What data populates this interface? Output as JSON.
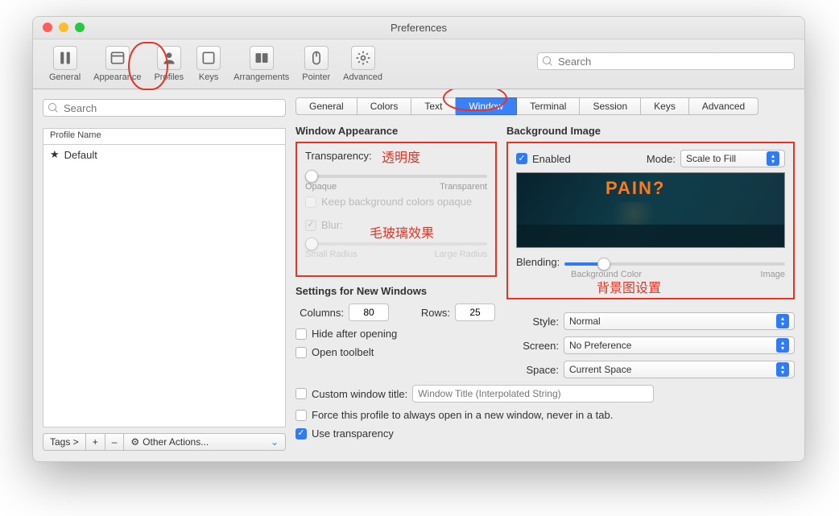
{
  "title": "Preferences",
  "toolbar": [
    {
      "id": "general",
      "label": "General"
    },
    {
      "id": "appearance",
      "label": "Appearance"
    },
    {
      "id": "profiles",
      "label": "Profiles"
    },
    {
      "id": "keys",
      "label": "Keys"
    },
    {
      "id": "arrangements",
      "label": "Arrangements"
    },
    {
      "id": "pointer",
      "label": "Pointer"
    },
    {
      "id": "advanced",
      "label": "Advanced"
    }
  ],
  "top_search_placeholder": "Search",
  "sidebar": {
    "search_placeholder": "Search",
    "header": "Profile Name",
    "items": [
      {
        "label": "Default",
        "starred": true
      }
    ],
    "footer": {
      "tags": "Tags >",
      "plus": "+",
      "minus": "–",
      "other": "Other Actions..."
    }
  },
  "tabs": [
    "General",
    "Colors",
    "Text",
    "Window",
    "Terminal",
    "Session",
    "Keys",
    "Advanced"
  ],
  "active_tab": "Window",
  "window_appearance": {
    "title": "Window Appearance",
    "transparency_label": "Transparency:",
    "transparency_value": 0,
    "opaque": "Opaque",
    "transparent": "Transparent",
    "keep_bg_label": "Keep background colors opaque",
    "keep_bg_checked": false,
    "blur_label": "Blur:",
    "blur_checked": true,
    "blur_value": 0,
    "small_radius": "Small Radius",
    "large_radius": "Large Radius",
    "ann_transparency": "透明度",
    "ann_blur": "毛玻璃效果"
  },
  "background_image": {
    "title": "Background Image",
    "enabled_label": "Enabled",
    "enabled_checked": true,
    "mode_label": "Mode:",
    "mode_value": "Scale to Fill",
    "neon_text": "PAIN?",
    "blending_label": "Blending:",
    "blending_value": 16,
    "blend_left": "Background Color",
    "blend_right": "Image",
    "ann": "背景图设置"
  },
  "new_windows": {
    "title": "Settings for New Windows",
    "columns_label": "Columns:",
    "columns_value": "80",
    "rows_label": "Rows:",
    "rows_value": "25",
    "hide_label": "Hide after opening",
    "hide_checked": false,
    "toolbelt_label": "Open toolbelt",
    "toolbelt_checked": false,
    "customtitle_label": "Custom window title:",
    "customtitle_checked": false,
    "customtitle_placeholder": "Window Title (Interpolated String)",
    "force_label": "Force this profile to always open in a new window, never in a tab.",
    "force_checked": false,
    "use_transparency_label": "Use transparency",
    "use_transparency_checked": true,
    "style_label": "Style:",
    "style_value": "Normal",
    "screen_label": "Screen:",
    "screen_value": "No Preference",
    "space_label": "Space:",
    "space_value": "Current Space"
  },
  "colors": {
    "accent": "#2f7af7",
    "annotation": "#e83224"
  }
}
